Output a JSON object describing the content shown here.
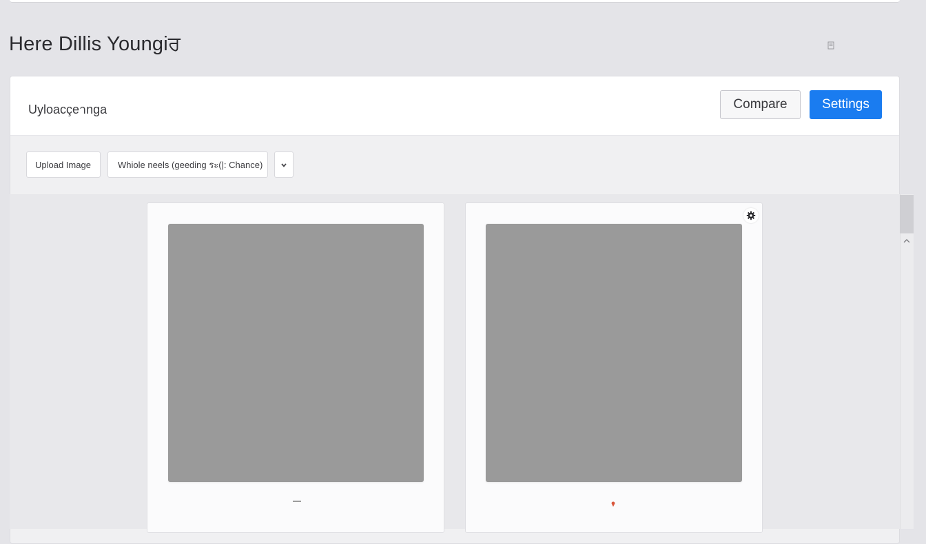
{
  "page": {
    "title": "Here Dillis Youngiਰ"
  },
  "card": {
    "title": "Uyloacçeาnga",
    "compare_label": "Compare",
    "settings_label": "Settings"
  },
  "toolbar": {
    "upload_label": "Upload Image",
    "select_value": "Whiole neels (geeding ระ(|: Chance)"
  },
  "icons": {
    "header": "document-icon",
    "chevron": "chevron-down-icon",
    "gear": "gear-icon",
    "scroll_up": "chevron-up-icon",
    "pin": "pin-icon"
  },
  "colors": {
    "accent": "#1a7cf0",
    "preview": "#9a9a9a",
    "pin": "#d9573c"
  }
}
